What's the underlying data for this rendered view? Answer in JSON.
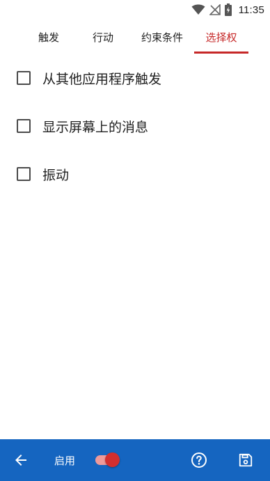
{
  "status_bar": {
    "time": "11:35",
    "icons": [
      "wifi-icon",
      "no-signal-icon",
      "battery-charging-icon"
    ]
  },
  "tabs": [
    {
      "label": "触发",
      "active": false
    },
    {
      "label": "行动",
      "active": false
    },
    {
      "label": "约束条件",
      "active": false
    },
    {
      "label": "选择权",
      "active": true
    }
  ],
  "options": [
    {
      "label": "从其他应用程序触发",
      "checked": false
    },
    {
      "label": "显示屏幕上的消息",
      "checked": false
    },
    {
      "label": "振动",
      "checked": false
    }
  ],
  "bottom_bar": {
    "enable_label": "启用",
    "toggle_on": true,
    "icons": [
      "back-arrow-icon",
      "help-icon",
      "save-icon"
    ]
  },
  "colors": {
    "accent": "#c62828",
    "bottom_bar": "#1565c0",
    "toggle_thumb": "#d32f2f",
    "toggle_track": "#ef9a9a"
  }
}
